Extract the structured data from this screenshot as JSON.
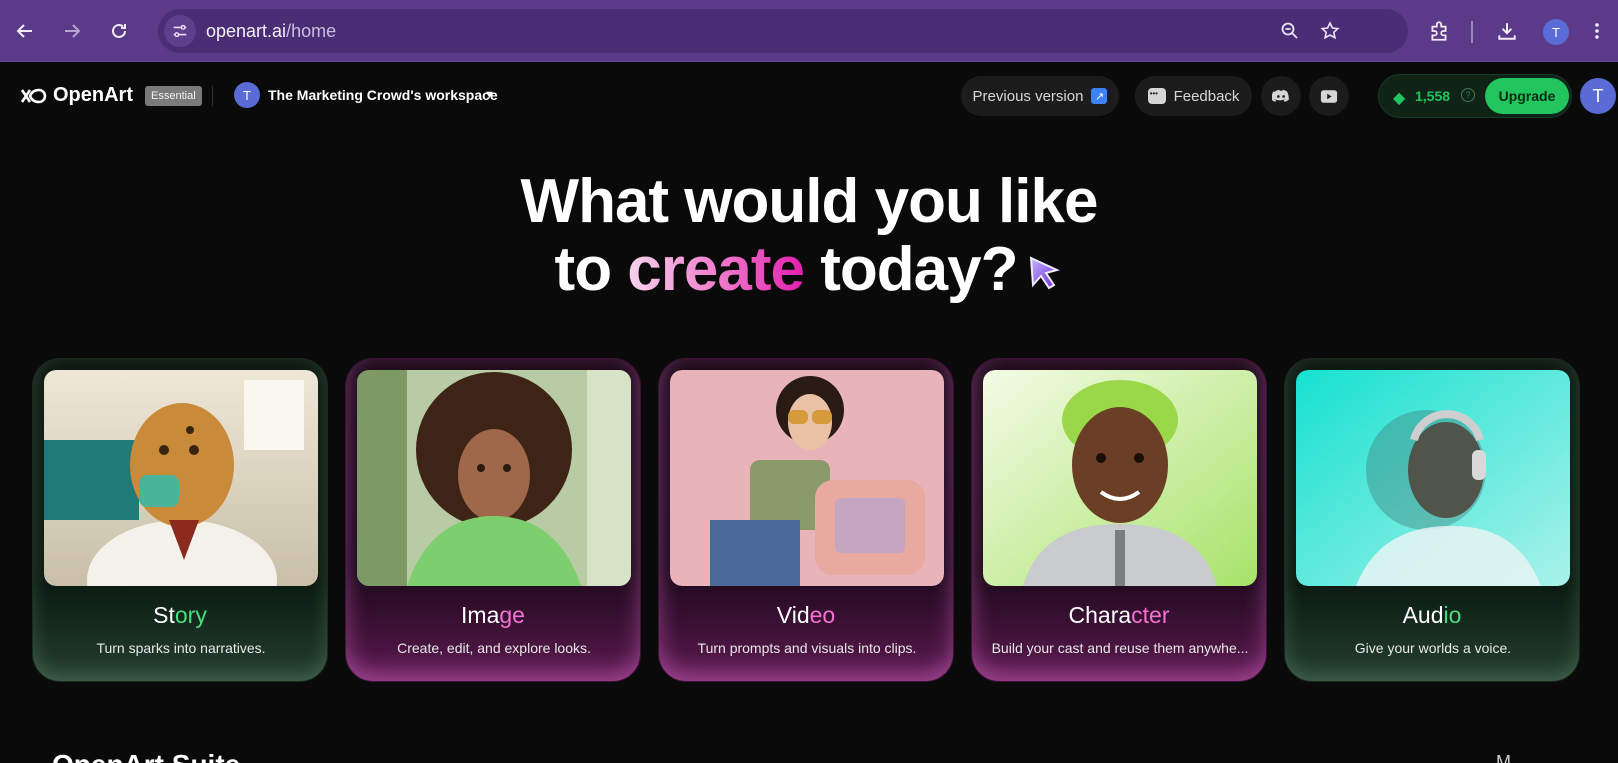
{
  "browser": {
    "url_host": "openart.ai",
    "url_path": "/home",
    "profile_initial": "T",
    "icons": [
      "back-arrow-icon",
      "forward-arrow-icon",
      "reload-icon",
      "site-settings-icon",
      "zoom-icon",
      "bookmark-star-icon",
      "extensions-icon",
      "download-icon",
      "kebab-menu-icon"
    ]
  },
  "header": {
    "logo_text": "OpenArt",
    "plan_badge": "Essential",
    "workspace_initial": "T",
    "workspace_name": "The Marketing Crowd's workspace",
    "previous_version": "Previous version",
    "feedback": "Feedback",
    "credits": "1,558",
    "upgrade": "Upgrade",
    "user_initial": "T"
  },
  "hero": {
    "line1": "What would you like",
    "line2_pre": "to ",
    "line2_highlight": "create",
    "line2_post": " today?"
  },
  "cards": [
    {
      "title_main": "St",
      "title_accent": "ory",
      "desc": "Turn sparks into narratives.",
      "style": "green"
    },
    {
      "title_main": "Ima",
      "title_accent": "ge",
      "desc": "Create, edit, and explore looks.",
      "style": "pink"
    },
    {
      "title_main": "Vid",
      "title_accent": "eo",
      "desc": "Turn prompts and visuals into clips.",
      "style": "pink"
    },
    {
      "title_main": "Chara",
      "title_accent": "cter",
      "desc": "Build your cast and reuse them anywhe...",
      "style": "pink"
    },
    {
      "title_main": "Aud",
      "title_accent": "io",
      "desc": "Give your worlds a voice.",
      "style": "green"
    }
  ],
  "suite": {
    "title": "OpenArt Suite",
    "more": "M"
  },
  "colors": {
    "chrome": "#5b3a8a",
    "background": "#0a0a0a",
    "accent_green": "#22c55e",
    "accent_pink": "#f472d0"
  }
}
